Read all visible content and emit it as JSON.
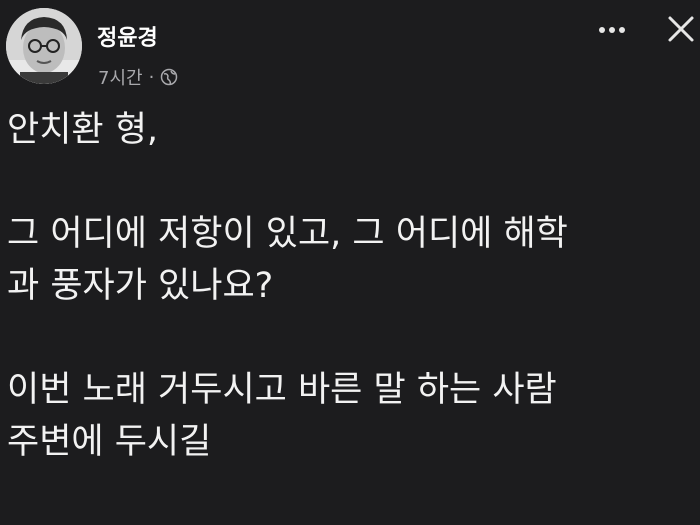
{
  "post": {
    "author": "정윤경",
    "time": "7시간",
    "separator": "·",
    "privacy_icon": "globe-icon",
    "lines": [
      "안치환 형,",
      "그 어디에 저항이 있고, 그 어디에 해학",
      "과 풍자가 있나요?",
      "이번 노래 거두시고 바른 말 하는 사람",
      "주변에 두시길"
    ]
  },
  "toolbar": {
    "more_icon": "more-horizontal-icon",
    "close_icon": "close-icon"
  },
  "colors": {
    "background": "#1c1c1e",
    "text": "#f2f2f2",
    "secondary_text": "#a8a8ac"
  }
}
